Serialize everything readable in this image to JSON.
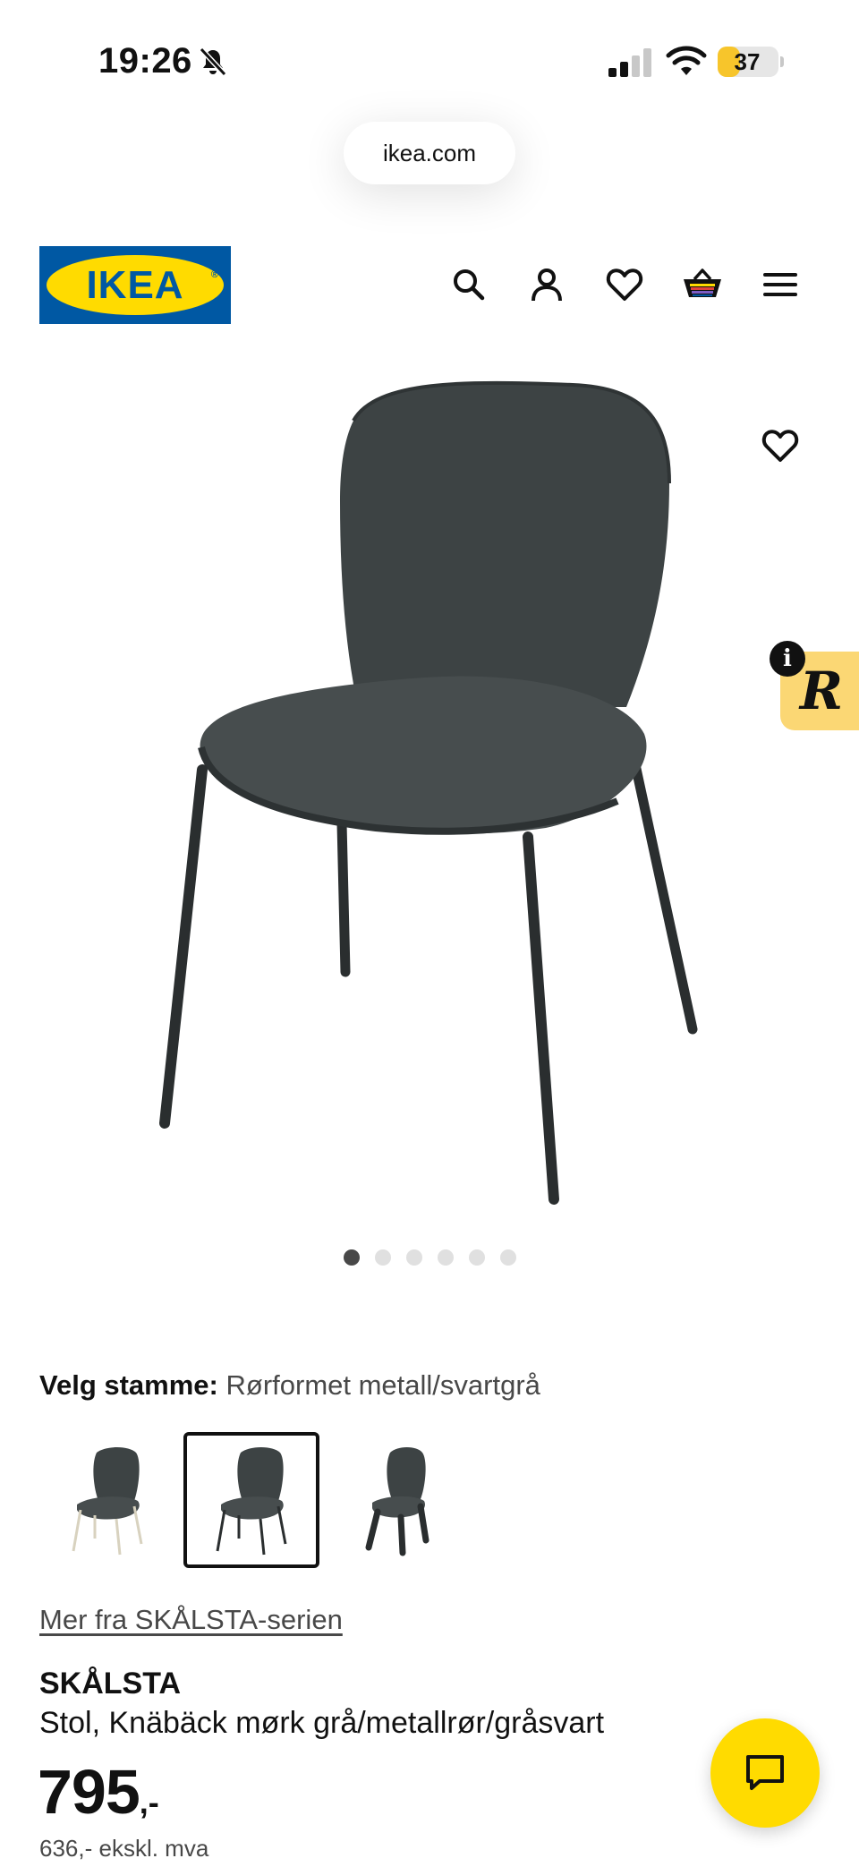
{
  "status_bar": {
    "time": "19:26",
    "battery_percent": "37",
    "battery_level": 0.37,
    "icons": [
      "bell-slash-icon",
      "signal-icon",
      "wifi-icon",
      "battery-icon"
    ]
  },
  "browser": {
    "url": "ikea.com"
  },
  "header": {
    "logo_text": "IKEA",
    "brand_colors": {
      "blue": "#0058a3",
      "yellow": "#ffdb00"
    },
    "icons": [
      "search-icon",
      "account-icon",
      "heart-icon",
      "cart-icon",
      "menu-icon"
    ]
  },
  "gallery": {
    "dot_count": 6,
    "active_index": 0,
    "favorite_icon": "heart-icon",
    "badge_letter": "R",
    "info_letter": "i"
  },
  "variant": {
    "label": "Velg stamme:",
    "value": "Rørformet metall/svartgrå",
    "selected_index": 1
  },
  "product": {
    "series_link": "Mer fra SKÅLSTA-serien",
    "name": "SKÅLSTA",
    "description": "Stol, Knäbäck mørk grå/metallrør/gråsvart",
    "price_main": "795",
    "price_suffix": ",-",
    "price_ex_vat": "636,- ekskl. mva"
  },
  "chat": {
    "icon": "chat-icon"
  }
}
